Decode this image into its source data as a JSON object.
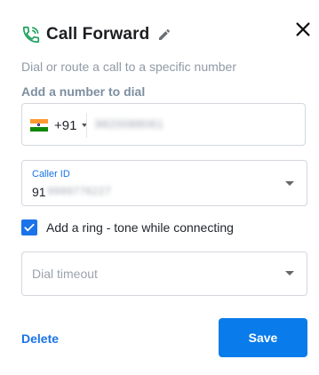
{
  "dialog": {
    "title": "Call Forward",
    "subtitle": "Dial or route a call to a specific number",
    "icons": {
      "title_icon": "phone-forward-icon",
      "edit": "pencil-icon",
      "close": "close-icon"
    },
    "accent_color": "#1a73e8"
  },
  "add_number": {
    "label": "Add a number to dial",
    "country_flag": "india-flag-icon",
    "dial_code": "+91",
    "phone_value": "9820088061"
  },
  "caller_id": {
    "label": "Caller ID",
    "value_prefix": "91",
    "value_rest": "9999776227"
  },
  "ring_option": {
    "checked": true,
    "label": "Add a ring - tone while connecting"
  },
  "dial_timeout": {
    "placeholder": "Dial timeout"
  },
  "actions": {
    "delete_label": "Delete",
    "save_label": "Save"
  }
}
